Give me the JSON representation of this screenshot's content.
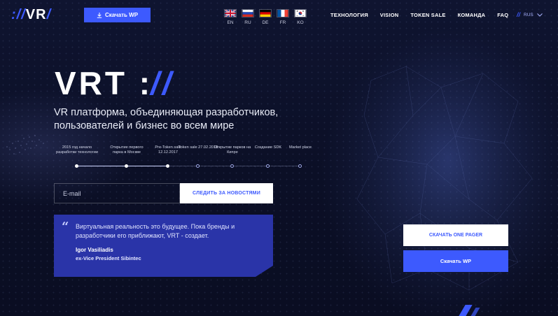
{
  "brand": {
    "logo_slashes": "://",
    "logo_text": "VR"
  },
  "header": {
    "download_wp": "Скачать WP",
    "flags": [
      {
        "code": "EN",
        "icon": "uk-flag-icon"
      },
      {
        "code": "RU",
        "icon": "russia-flag-icon"
      },
      {
        "code": "DE",
        "icon": "germany-flag-icon"
      },
      {
        "code": "FR",
        "icon": "france-flag-icon"
      },
      {
        "code": "KO",
        "icon": "korea-flag-icon"
      }
    ],
    "nav": [
      "ТЕХНОЛОГИЯ",
      "VISION",
      "TOKEN SALE",
      "КОМАНДА",
      "FAQ"
    ],
    "language": "RUS"
  },
  "hero": {
    "title_main": "VRT",
    "title_colon": ":",
    "title_slashes": "//",
    "subtitle": "VR платформа, объединяющая разработчиков, пользователей и бизнес во всем мире"
  },
  "timeline": [
    {
      "label": "2015 год начало разработки технологии",
      "done": true
    },
    {
      "label": "Открытие первого парка в Москве",
      "done": true
    },
    {
      "label": "Pre-Token sale 12.12.2017",
      "done": true
    },
    {
      "label": "Token sale 27.02.2018",
      "done": false
    },
    {
      "label": "Открытие парков на Кипре",
      "done": false
    },
    {
      "label": "Создание SDK",
      "done": false
    },
    {
      "label": "Market place",
      "done": false
    }
  ],
  "subscribe": {
    "placeholder": "E-mail",
    "button": "СЛЕДИТЬ ЗА НОВОСТЯМИ"
  },
  "quote": {
    "text": "Виртуальная реальность это будущее. Пока бренды и разработчики его приближают, VRT - создает.",
    "author": "Igor Vasiliadis",
    "role": "ex-Vice President Sibintec"
  },
  "cta": {
    "one_pager": "СКАЧАТЬ ONE PAGER",
    "download_wp": "Скачать WP"
  },
  "colors": {
    "accent": "#3d5afe",
    "background": "#0c1028",
    "quote_bg": "#2a34a8"
  }
}
